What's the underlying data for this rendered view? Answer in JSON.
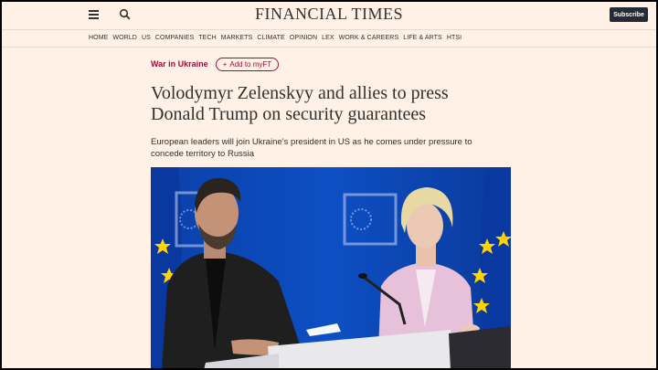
{
  "header": {
    "logo": "FINANCIAL TIMES",
    "subscribe_label": "Subscribe"
  },
  "nav": {
    "items": [
      "HOME",
      "WORLD",
      "US",
      "COMPANIES",
      "TECH",
      "MARKETS",
      "CLIMATE",
      "OPINION",
      "LEX",
      "WORK & CAREERS",
      "LIFE & ARTS",
      "HTSI"
    ]
  },
  "article": {
    "topic": "War in Ukraine",
    "myft_label": "Add to myFT",
    "headline_lines": [
      "Volodymyr Zelenskyy and allies to press",
      "Donald Trump on security guarantees"
    ],
    "standfirst_lines": [
      "European leaders will join Ukraine’s president in US as he comes under pressure to",
      "concede territory to Russia"
    ]
  },
  "colors": {
    "page_background": "#fff1e5",
    "claret": "#990f3d",
    "text": "#33302e",
    "subscribe_bg": "#262a33",
    "eu_blue": "#0a3a9a",
    "eu_star": "#ffd200"
  },
  "icons": {
    "menu": "hamburger-menu-icon",
    "search": "search-icon",
    "add": "plus-icon"
  }
}
